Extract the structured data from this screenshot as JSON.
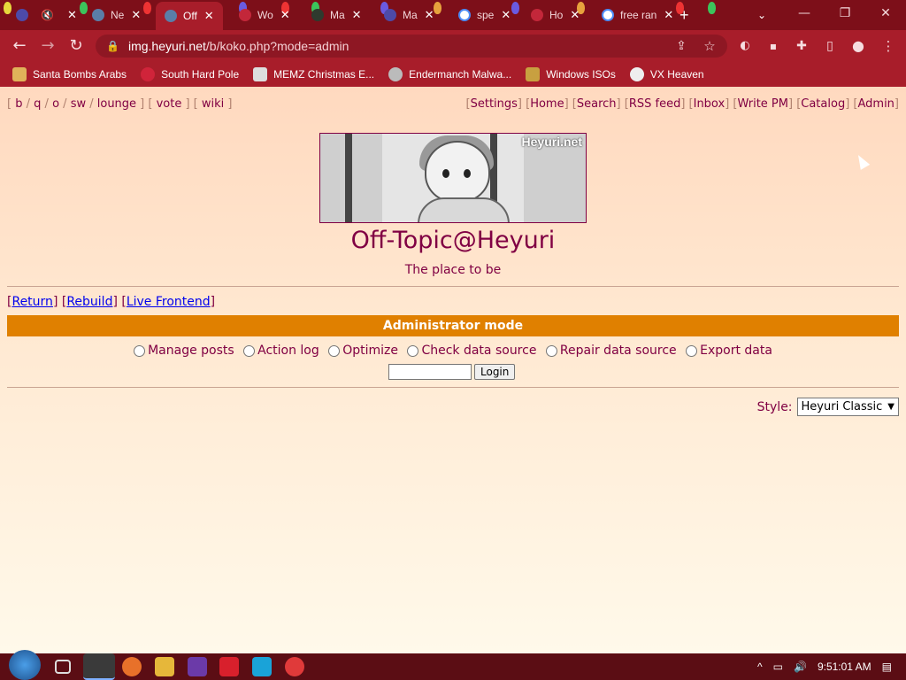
{
  "browser": {
    "tabs": [
      {
        "label": "",
        "favicon": "app-icon"
      },
      {
        "label": "",
        "favicon": "speaker-icon"
      },
      {
        "label": "Ne",
        "favicon": "globe-icon"
      },
      {
        "label": "Off",
        "favicon": "globe-icon",
        "active": true
      },
      {
        "label": "Wo",
        "favicon": "site-icon"
      },
      {
        "label": "Ma",
        "favicon": "site-icon"
      },
      {
        "label": "Ma",
        "favicon": "site-icon"
      },
      {
        "label": "spe",
        "favicon": "google-icon"
      },
      {
        "label": "Ho",
        "favicon": "site-icon"
      },
      {
        "label": "free ran",
        "favicon": "google-icon"
      }
    ],
    "url_host": "img.heyuri.net",
    "url_path": "/b/koko.php?mode=admin",
    "bookmarks": [
      {
        "label": "Santa Bombs Arabs"
      },
      {
        "label": "South Hard Pole"
      },
      {
        "label": "MEMZ Christmas E..."
      },
      {
        "label": "Endermanch Malwa..."
      },
      {
        "label": "Windows ISOs"
      },
      {
        "label": "VX Heaven"
      }
    ],
    "theme_color": "#a81d2a"
  },
  "page": {
    "boardlist": {
      "b": "b",
      "q": "q",
      "o": "o",
      "sw": "sw",
      "lounge": "lounge",
      "vote": "vote",
      "wiki": "wiki"
    },
    "toplinks": {
      "settings": "Settings",
      "home": "Home",
      "search": "Search",
      "rss": "RSS feed",
      "inbox": "Inbox",
      "write_pm": "Write PM",
      "catalog": "Catalog",
      "admin": "Admin"
    },
    "banner_watermark": "Heyuri.net",
    "title": "Off-Topic@Heyuri",
    "subtitle": "The place to be",
    "admin_links": {
      "return": "Return",
      "rebuild": "Rebuild",
      "live_frontend": "Live Frontend"
    },
    "admin_bar": "Administrator mode",
    "admin_options": [
      "Manage posts",
      "Action log",
      "Optimize",
      "Check data source",
      "Repair data source",
      "Export data"
    ],
    "login_button": "Login",
    "style_label": "Style:",
    "style_value": "Heyuri Classic",
    "text_color": "#800043",
    "admin_bar_color": "#e08000"
  },
  "taskbar": {
    "time": "9:51:01 AM"
  }
}
